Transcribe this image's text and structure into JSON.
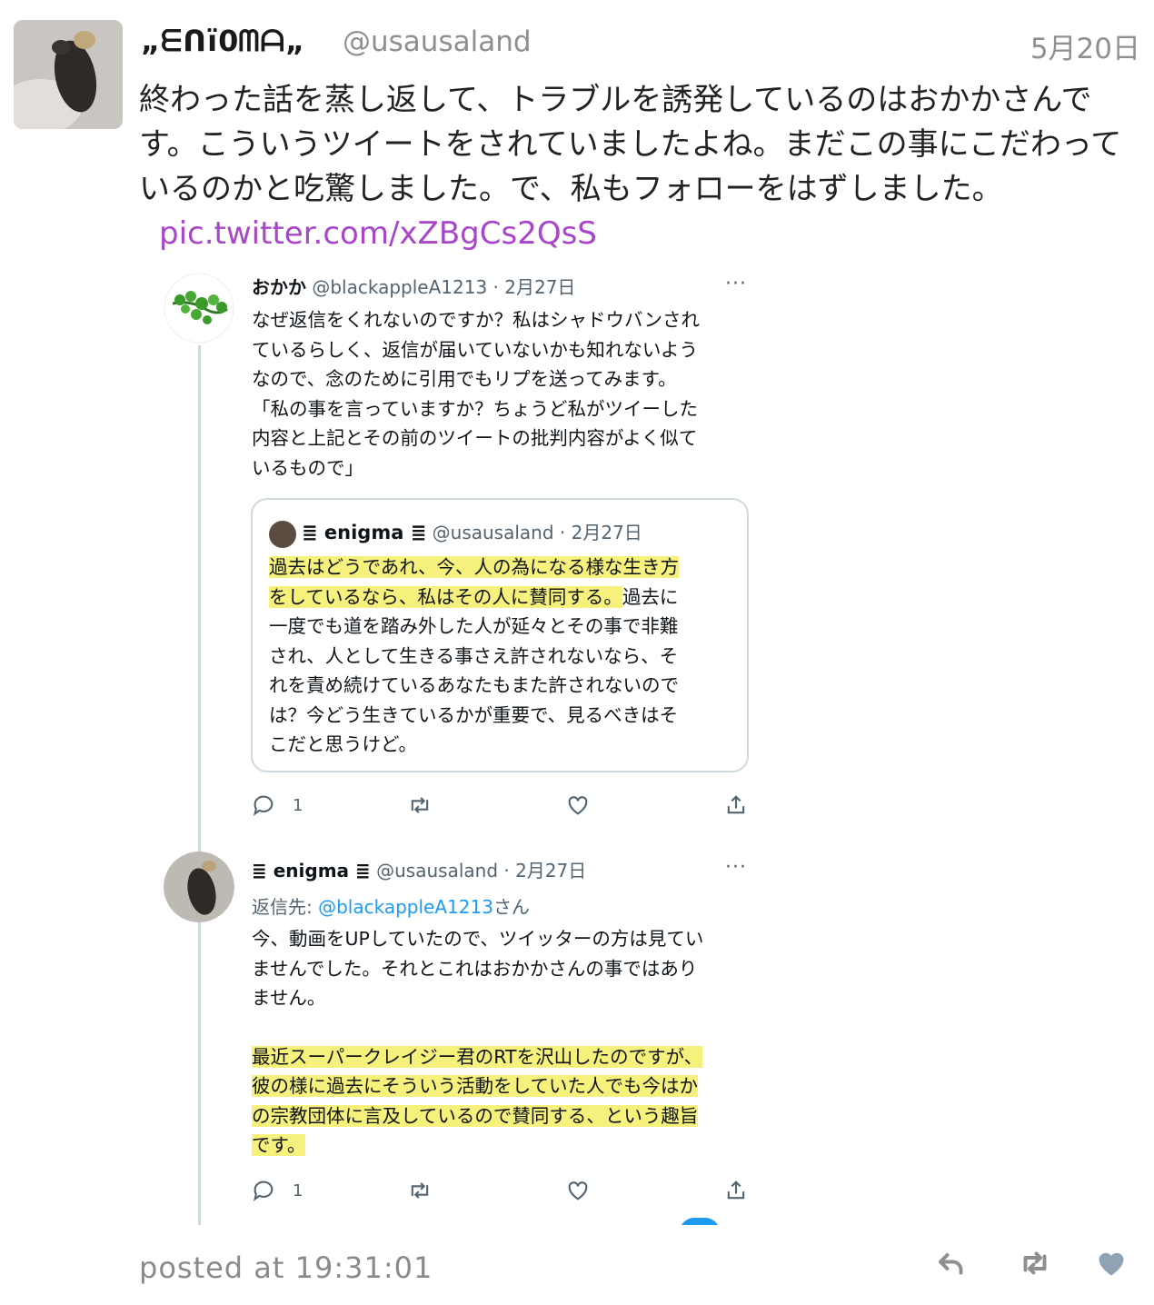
{
  "tweet": {
    "display_name": "„ᗴᑎï߀ᗰᗩ„",
    "handle": "@usausaland",
    "date": "5月20日",
    "text": "終わった話を蒸し返して、トラブルを誘発しているのはおかかさんです。こういうツイートをされていましたよね。まだこの事にこだわっているのかと吃驚しました。で、私もフォローをはずしました。",
    "link": "pic.twitter.com/xZBgCs2QsS",
    "posted_at": "posted at 19:31:01"
  },
  "screenshot": {
    "tweet1": {
      "name": "おかか",
      "handle_date": "@blackappleA1213 · 2月27日",
      "text_lines": [
        "なぜ返信をくれないのですか？私はシャドウバンされ",
        "ているらしく、返信が届いていないかも知れないよう",
        "なので、念のために引用でもリプを送ってみます。",
        "「私の事を言っていますか？ちょうど私がツイーした",
        "内容と上記とその前のツイートの批判内容がよく似て",
        "いるもので」"
      ],
      "reply_count": "1"
    },
    "quote": {
      "name": "≣ enigma ≣",
      "handle_date": "@usausaland · 2月27日",
      "highlighted": [
        "過去はどうであれ、今、人の為になる様な生き方",
        "をしているなら、私はその人に賛同する。"
      ],
      "lines": [
        "過去に",
        "一度でも道を踏み外した人が延々とその事で非難",
        "され、人として生きる事さえ許されないなら、そ",
        "れを責め続けているあなたもまた許されないので",
        "は？今どう生きているかが重要で、見るべきはそ",
        "こだと思うけど。"
      ]
    },
    "tweet2": {
      "name": "≣ enigma ≣",
      "handle_date": "@usausaland · 2月27日",
      "reply_prefix": "返信先: ",
      "reply_mention": "@blackappleA1213",
      "reply_suffix": "さん",
      "text_lines": [
        "今、動画をUPしていたので、ツイッターの方は見てい",
        "ませんでした。それとこれはおかかさんの事ではあり",
        "ません。"
      ],
      "highlight_lines": [
        "最近スーパークレイジー君のRTを沢山したのですが、",
        "彼の様に過去にそういう活動をしていた人でも今はか",
        "の宗教団体に言及しているので賛同する、という趣旨",
        "です。"
      ],
      "reply_count": "1"
    },
    "more_label": "···"
  },
  "colors": {
    "link": "#a845c9",
    "highlight": "#f6f07c",
    "mention": "#1d9bf0",
    "muted": "#8a8a8a"
  }
}
